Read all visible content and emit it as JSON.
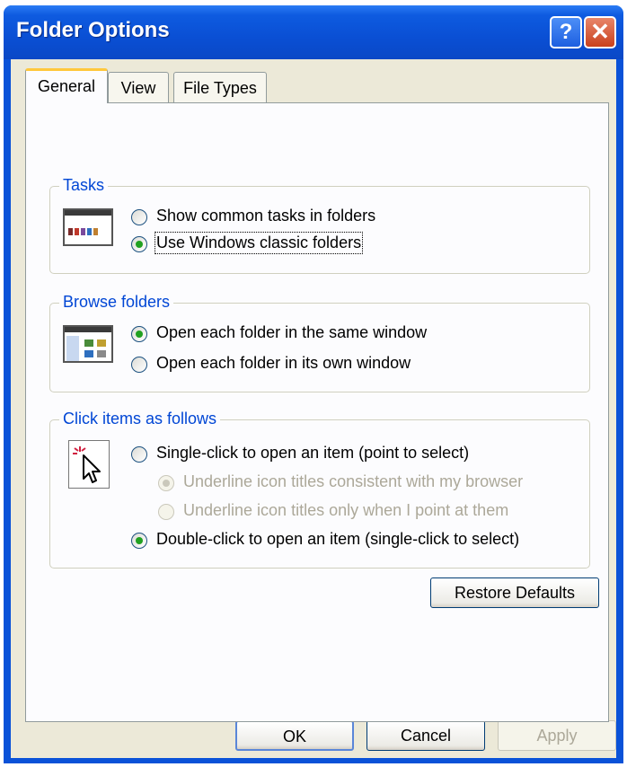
{
  "window": {
    "title": "Folder Options",
    "help_label": "?",
    "close_label": "✕"
  },
  "tabs": [
    {
      "label": "General",
      "selected": true
    },
    {
      "label": "View",
      "selected": false
    },
    {
      "label": "File Types",
      "selected": false
    }
  ],
  "tasks": {
    "label": "Tasks",
    "options": [
      {
        "label": "Show common tasks in folders",
        "checked": false
      },
      {
        "label": "Use Windows classic folders",
        "checked": true
      }
    ]
  },
  "browse": {
    "label": "Browse folders",
    "options": [
      {
        "label": "Open each folder in the same window",
        "checked": true
      },
      {
        "label": "Open each folder in its own window",
        "checked": false
      }
    ]
  },
  "click": {
    "label": "Click items as follows",
    "options": [
      {
        "label": "Single-click to open an item (point to select)",
        "checked": false,
        "enabled": true
      },
      {
        "label": "Underline icon titles consistent with my browser",
        "checked": true,
        "enabled": false
      },
      {
        "label": "Underline icon titles only when I point at them",
        "checked": false,
        "enabled": false
      },
      {
        "label": "Double-click to open an item (single-click to select)",
        "checked": true,
        "enabled": true
      }
    ]
  },
  "buttons": {
    "restore_defaults": "Restore Defaults",
    "ok": "OK",
    "cancel": "Cancel",
    "apply": "Apply"
  },
  "colors": {
    "title_bar": "#0a52d8",
    "dialog_bg": "#ece9d8",
    "group_label": "#0046d5",
    "radio_checked": "#21a121",
    "tab_highlight": "#ffc83c"
  }
}
